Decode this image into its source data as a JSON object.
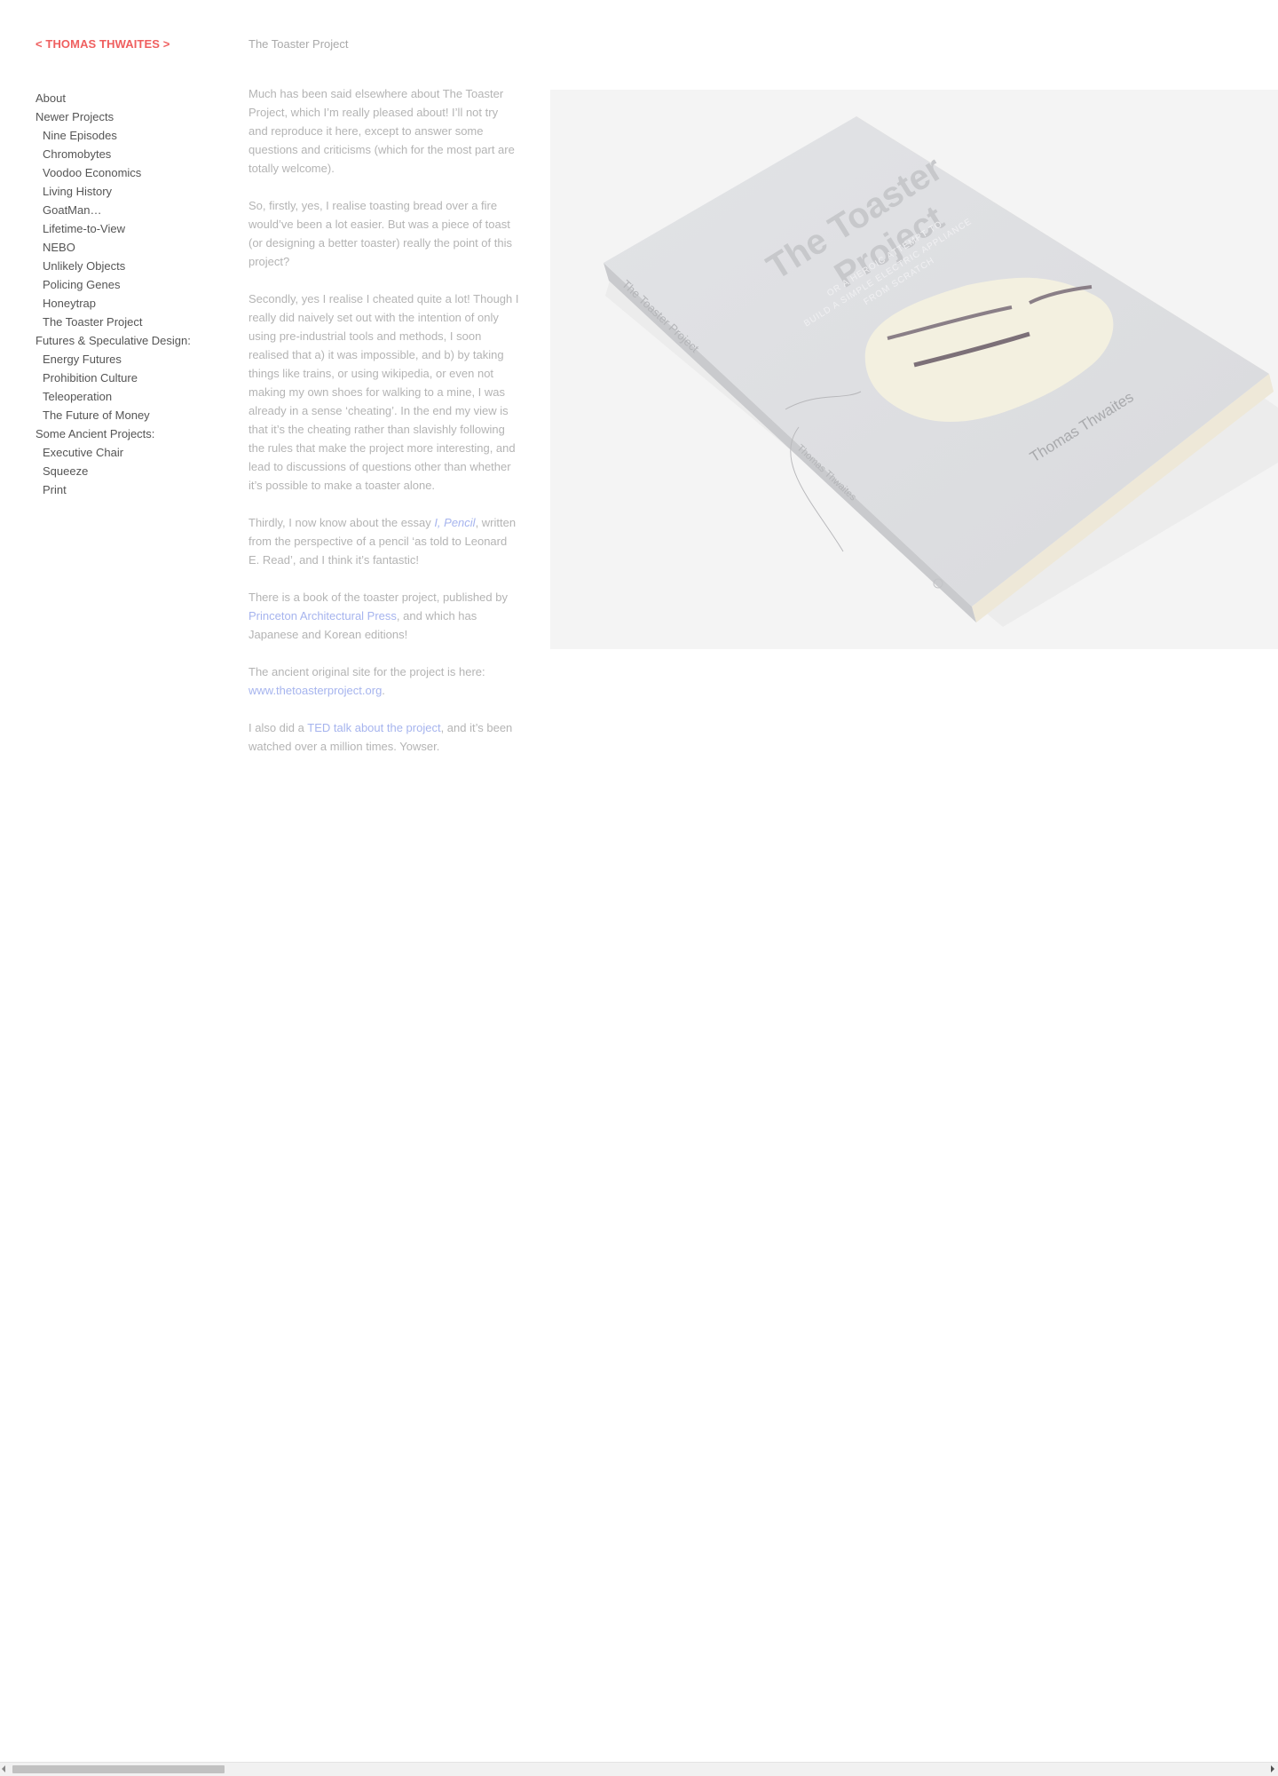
{
  "site": {
    "title": "< THOMAS THWAITES >"
  },
  "sidebar": {
    "items": [
      {
        "label": "About"
      },
      {
        "label": "Newer Projects"
      },
      {
        "label": "Nine Episodes"
      },
      {
        "label": "Chromobytes"
      },
      {
        "label": "Voodoo Economics"
      },
      {
        "label": "Living History"
      },
      {
        "label": "GoatMan…"
      },
      {
        "label": "Lifetime-to-View"
      },
      {
        "label": "NEBO"
      },
      {
        "label": "Unlikely Objects"
      },
      {
        "label": "Policing Genes"
      },
      {
        "label": "Honeytrap"
      },
      {
        "label": "The Toaster Project"
      },
      {
        "label": "Futures & Speculative Design:"
      },
      {
        "label": "Energy Futures"
      },
      {
        "label": "Prohibition Culture"
      },
      {
        "label": "Teleoperation"
      },
      {
        "label": "The Future of Money"
      },
      {
        "label": "Some Ancient Projects:"
      },
      {
        "label": "Executive Chair"
      },
      {
        "label": "Squeeze"
      },
      {
        "label": "Print"
      }
    ]
  },
  "main": {
    "page_title": "The Toaster Project",
    "p1": "Much has been said elsewhere about The Toaster Project, which I’m really pleased about! I’ll not try and reproduce it here, except to answer some questions and criticisms (which for the most part are totally welcome).",
    "p2": "So, firstly, yes, I realise toasting bread over a fire would’ve been a lot easier. But was a piece of toast (or designing a better toaster) really the point of this project?",
    "p3": "Secondly, yes I realise I cheated quite a lot! Though I really did naively set out with the intention of only using pre-industrial tools and methods, I soon realised that a) it was impossible, and b) by taking things like trains, or using wikipedia, or even not making my own shoes for walking to a mine, I was already in a sense ‘cheating’. In the end my view is that it’s the cheating rather than slavishly following the rules that make the project more interesting, and lead to discussions of questions other than whether it’s possible to make a toaster alone.",
    "p4": {
      "before": "Thirdly, I now know about the essay ",
      "link": "I, Pencil",
      "after": ", written from the perspective of a pencil ‘as told to Leonard E. Read’, and I think it’s fantastic!"
    },
    "p5": {
      "before": "There is a book of the toaster project, published by ",
      "link": "Princeton Architectural Press",
      "after": ", and which has Japanese and Korean editions!"
    },
    "p6": {
      "before": "The ancient original site for the project is here: ",
      "link": "www.thetoasterproject.org",
      "after": "."
    },
    "p7": {
      "before": "I also did a ",
      "link": "TED talk about the project",
      "after": ", and it’s been watched over a million times. Yowser."
    }
  },
  "hero": {
    "book_title_line1": "The Toaster",
    "book_title_line2": "Project",
    "book_subtitle_line1": "OR A HEROIC ATTEMPT TO",
    "book_subtitle_line2": "BUILD A SIMPLE ELECTRIC APPLIANCE",
    "book_subtitle_line3": "FROM SCRATCH",
    "book_author": "Thomas Thwaites",
    "spine_title": "The Toaster Project",
    "spine_author": "Thomas Thwaites"
  },
  "colors": {
    "accent": "#ef5f5f",
    "link": "#a6b4ee",
    "body_text": "#b4b4b4",
    "nav_text": "#555555"
  }
}
